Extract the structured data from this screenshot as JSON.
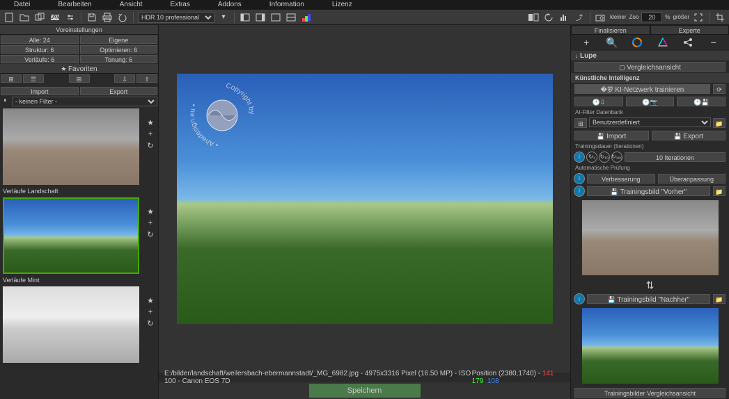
{
  "menu": [
    "Datei",
    "Bearbeiten",
    "Ansicht",
    "Extras",
    "Addons",
    "Information",
    "Lizenz"
  ],
  "hdr_select": "HDR 10 professional",
  "zoom": {
    "kleiner": "kleiner",
    "label": "Zoo",
    "value": "20",
    "pct": "%",
    "groesser": "größer"
  },
  "left": {
    "title": "Voreinstellungen",
    "row1": [
      "Alle: 24",
      "Eigene"
    ],
    "row2": [
      "Struktur: 6",
      "Optimieren: 6"
    ],
    "row3": [
      "Verläufe: 6",
      "Tonung: 6"
    ],
    "fav": "Favoriten",
    "ie": [
      "Import",
      "Export"
    ],
    "filter": "- keinen Filter -",
    "t1": "Verläufe Landschaft",
    "t2": "Verläufe Mint"
  },
  "status": {
    "path": "E:/bilder/landschaft/weilersbach-ebermannstadt/_MG_6982.jpg - 4975x3316 Pixel (16.50 MP)   - ISO 100 - Canon EOS 7D",
    "pos": "Position   (2380,1740) - ",
    "r": "141",
    "g": "179",
    "b": "108"
  },
  "save": "Speichern",
  "right": {
    "tabs": [
      "Finalisieren",
      "Experte"
    ],
    "lupe": "Lupe",
    "vergleich": "Vergleichsansicht",
    "ki": "Künstliche Intelligenz",
    "train": "KI-Netzwerk trainieren",
    "db": "AI-Filter Datenbank",
    "userdef": "Benutzerdefiniert",
    "imp": "Import",
    "exp": "Export",
    "iter": "Trainingsdauer (Iterationen)",
    "iterbtn": "10 Iterationen",
    "auto": "Automatische Prüfung",
    "verb": "Verbesserung",
    "anp": "Überanpassung",
    "before": "Trainingsbild \"Vorher\"",
    "after": "Trainingsbild \"Nachher\"",
    "footer": "Trainingsbilder Vergleichsansicht"
  }
}
